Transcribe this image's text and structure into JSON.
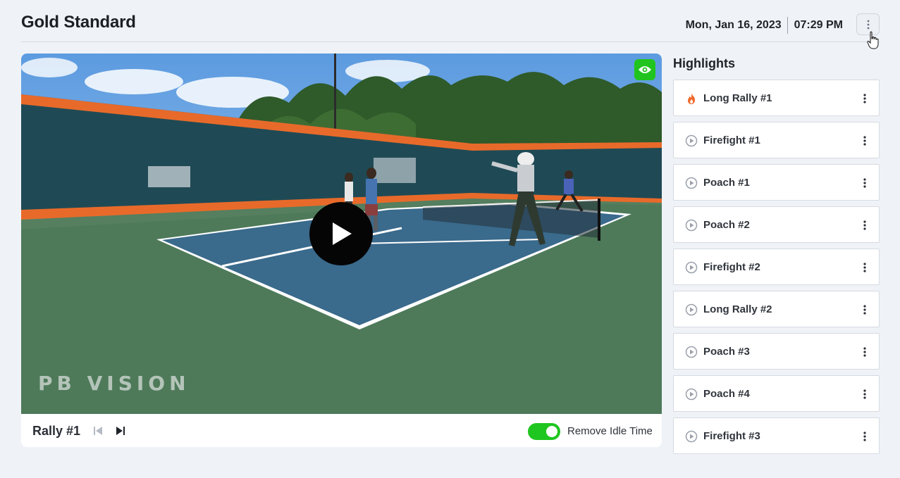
{
  "header": {
    "title": "Gold Standard",
    "date": "Mon, Jan 16, 2023",
    "time": "07:29 PM",
    "menu_icon": "vertical-ellipsis-icon"
  },
  "video": {
    "watermark": "PB VISION",
    "eye_icon": "eye-icon",
    "play_icon": "play-icon",
    "accent_color": "#21c41e"
  },
  "controls": {
    "rally_label": "Rally #1",
    "prev_icon": "skip-previous-icon",
    "next_icon": "skip-next-icon",
    "toggle_label": "Remove Idle Time",
    "toggle_on": true
  },
  "highlights": {
    "title": "Highlights",
    "items": [
      {
        "label": "Long Rally #1",
        "icon": "fire-icon",
        "active": true
      },
      {
        "label": "Firefight #1",
        "icon": "play-circle-icon"
      },
      {
        "label": "Poach #1",
        "icon": "play-circle-icon"
      },
      {
        "label": "Poach #2",
        "icon": "play-circle-icon"
      },
      {
        "label": "Firefight #2",
        "icon": "play-circle-icon"
      },
      {
        "label": "Long Rally #2",
        "icon": "play-circle-icon"
      },
      {
        "label": "Poach #3",
        "icon": "play-circle-icon"
      },
      {
        "label": "Poach #4",
        "icon": "play-circle-icon"
      },
      {
        "label": "Firefight #3",
        "icon": "play-circle-icon"
      }
    ]
  }
}
